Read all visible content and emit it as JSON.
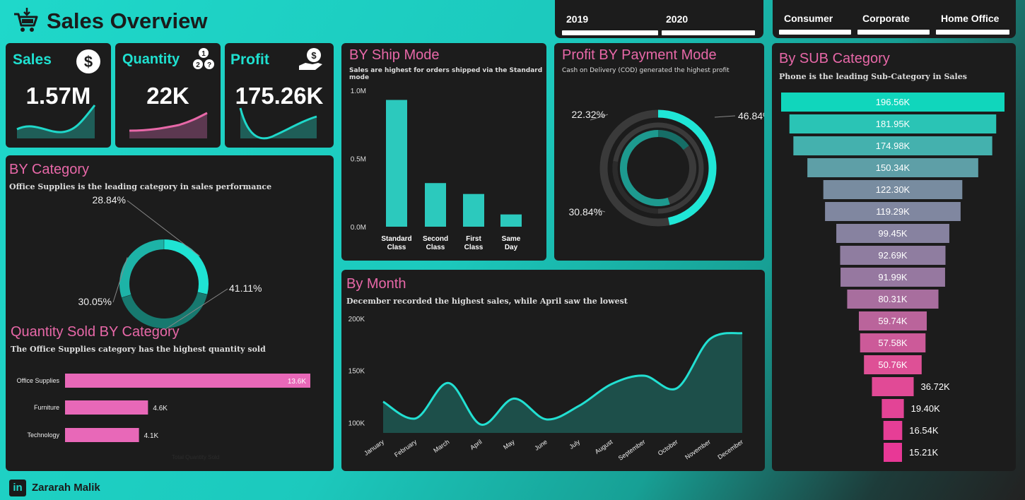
{
  "header": {
    "title": "Sales Overview"
  },
  "years": [
    "2019",
    "2020"
  ],
  "segments": [
    "Consumer",
    "Corporate",
    "Home Office"
  ],
  "kpis": [
    {
      "label": "Sales",
      "value": "1.57M",
      "icon": "dollar-circle-icon",
      "line_color": "#1fd8ca"
    },
    {
      "label": "Quantity",
      "value": "22K",
      "icon": "numbered-circles-icon",
      "line_color": "#e868a8"
    },
    {
      "label": "Profit",
      "value": "175.26K",
      "icon": "hand-money-icon",
      "line_color": "#1fd8ca"
    }
  ],
  "category": {
    "title": "BY Category",
    "subtitle": "Office Supplies is the leading category in sales performance",
    "labels": [
      "28.84%",
      "41.11%",
      "30.05%"
    ]
  },
  "qty_category": {
    "title": "Quantity Sold BY Category",
    "subtitle": "The Office Supplies category has the highest quantity sold",
    "axis_title": "Total Quantity Sold"
  },
  "ship_mode": {
    "title": "BY Ship Mode",
    "subtitle": "Sales are highest for orders shipped via the Standard mode"
  },
  "payment": {
    "title": "Profit BY Payment Mode",
    "subtitle": "Cash on Delivery (COD) generated the highest profit",
    "labels": [
      "46.84%",
      "22.32%",
      "30.84%"
    ]
  },
  "month": {
    "title": "By Month",
    "subtitle": "December recorded the highest sales, while April saw the lowest"
  },
  "subcat": {
    "title": "By SUB Category",
    "subtitle": "Phone is the leading Sub-Category in Sales"
  },
  "footer": {
    "author": "Zararah Malik",
    "icon": "linkedin-icon"
  },
  "colors": {
    "teal": "#1fd8ca",
    "pink": "#e868a8",
    "card": "#1c1c1c"
  },
  "chart_data": [
    {
      "type": "pie",
      "name": "category-donut",
      "values": [
        28.84,
        41.11,
        30.05
      ],
      "labels": [
        "28.84%",
        "41.11%",
        "30.05%"
      ]
    },
    {
      "type": "bar",
      "name": "quantity-by-category",
      "categories": [
        "Office Supplies",
        "Furniture",
        "Technology"
      ],
      "values": [
        13.6,
        4.6,
        4.1
      ],
      "value_labels": [
        "13.6K",
        "4.6K",
        "4.1K"
      ],
      "orientation": "horizontal",
      "xlim": [
        0,
        14.5
      ]
    },
    {
      "type": "bar",
      "name": "sales-by-ship-mode",
      "categories": [
        "Standard Class",
        "Second Class",
        "First Class",
        "Same Day"
      ],
      "values": [
        0.93,
        0.32,
        0.24,
        0.09
      ],
      "ylim": [
        0,
        1.0
      ],
      "yticks": [
        {
          "v": 1.0,
          "label": "1.0M"
        },
        {
          "v": 0.5,
          "label": "0.5M"
        },
        {
          "v": 0.0,
          "label": "0.0M"
        }
      ]
    },
    {
      "type": "pie",
      "name": "profit-by-payment-mode",
      "values": [
        46.84,
        22.32,
        30.84
      ],
      "labels": [
        "46.84%",
        "22.32%",
        "30.84%"
      ]
    },
    {
      "type": "area",
      "name": "sales-by-month",
      "categories": [
        "January",
        "February",
        "March",
        "April",
        "May",
        "June",
        "July",
        "August",
        "September",
        "October",
        "November",
        "December"
      ],
      "values": [
        120,
        104,
        138,
        98,
        123,
        103,
        116,
        137,
        145,
        133,
        180,
        186
      ],
      "ylim": [
        90,
        200
      ],
      "yticks": [
        {
          "v": 200,
          "label": "200K"
        },
        {
          "v": 150,
          "label": "150K"
        },
        {
          "v": 100,
          "label": "100K"
        }
      ]
    },
    {
      "type": "bar",
      "name": "sales-by-sub-category",
      "orientation": "funnel",
      "values": [
        196.56,
        181.95,
        174.98,
        150.34,
        122.3,
        119.29,
        99.45,
        92.69,
        91.99,
        80.31,
        59.74,
        57.58,
        50.76,
        36.72,
        19.4,
        16.54,
        15.21
      ],
      "value_labels": [
        "196.56K",
        "181.95K",
        "174.98K",
        "150.34K",
        "122.30K",
        "119.29K",
        "99.45K",
        "92.69K",
        "91.99K",
        "80.31K",
        "59.74K",
        "57.58K",
        "50.76K",
        "36.72K",
        "19.40K",
        "16.54K",
        "15.21K"
      ]
    }
  ]
}
